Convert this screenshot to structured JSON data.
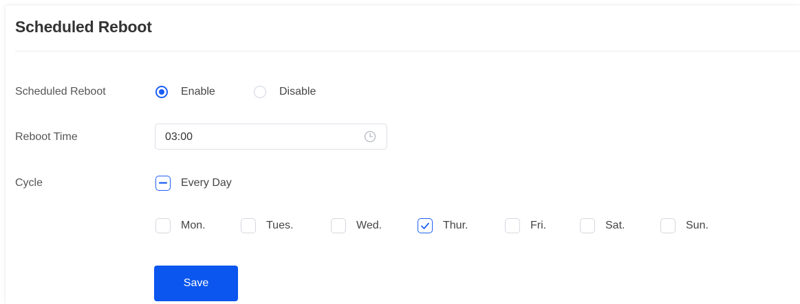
{
  "page": {
    "title": "Scheduled Reboot"
  },
  "form": {
    "reboot": {
      "label": "Scheduled Reboot",
      "options": [
        {
          "label": "Enable",
          "selected": true
        },
        {
          "label": "Disable",
          "selected": false
        }
      ]
    },
    "time": {
      "label": "Reboot Time",
      "value": "03:00",
      "icon": "clock-icon"
    },
    "cycle": {
      "label": "Cycle",
      "every_day": {
        "label": "Every Day",
        "state": "indeterminate"
      },
      "days": [
        {
          "label": "Mon.",
          "checked": false
        },
        {
          "label": "Tues.",
          "checked": false
        },
        {
          "label": "Wed.",
          "checked": false
        },
        {
          "label": "Thur.",
          "checked": true
        },
        {
          "label": "Fri.",
          "checked": false
        },
        {
          "label": "Sat.",
          "checked": false
        },
        {
          "label": "Sun.",
          "checked": false
        }
      ]
    },
    "save_label": "Save"
  },
  "colors": {
    "accent": "#1a5ef5",
    "button": "#0b56ee",
    "border": "#dcdfe6"
  }
}
